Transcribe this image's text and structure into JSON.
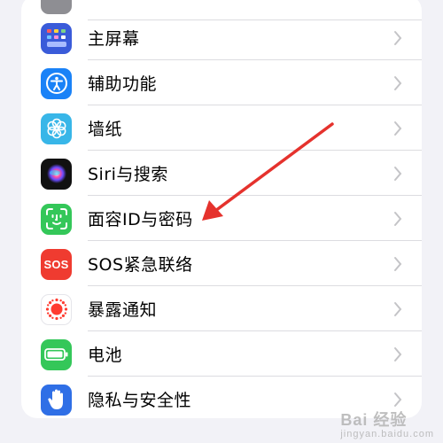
{
  "settings": {
    "items": [
      {
        "label": "主屏幕",
        "icon": "home-screen-icon"
      },
      {
        "label": "辅助功能",
        "icon": "accessibility-icon"
      },
      {
        "label": "墙纸",
        "icon": "wallpaper-icon"
      },
      {
        "label": "Siri与搜索",
        "icon": "siri-icon"
      },
      {
        "label": "面容ID与密码",
        "icon": "face-id-icon"
      },
      {
        "label": "SOS紧急联络",
        "icon": "sos-icon",
        "icon_text": "SOS"
      },
      {
        "label": "暴露通知",
        "icon": "exposure-notification-icon"
      },
      {
        "label": "电池",
        "icon": "battery-icon"
      },
      {
        "label": "隐私与安全性",
        "icon": "privacy-hand-icon"
      }
    ]
  },
  "colors": {
    "background": "#f2f2f7",
    "arrow": "#e5322d",
    "home_blue": "#3a5bd9",
    "accessibility_blue": "#1a82f7",
    "wallpaper_cyan": "#38b6e8",
    "face_id_green": "#34c759",
    "sos_red": "#ef3b30",
    "battery_green": "#34c759",
    "privacy_blue": "#2f6fe6"
  },
  "watermark": {
    "text": "Bai 经验",
    "subtext": "jingyan.baidu.com"
  }
}
